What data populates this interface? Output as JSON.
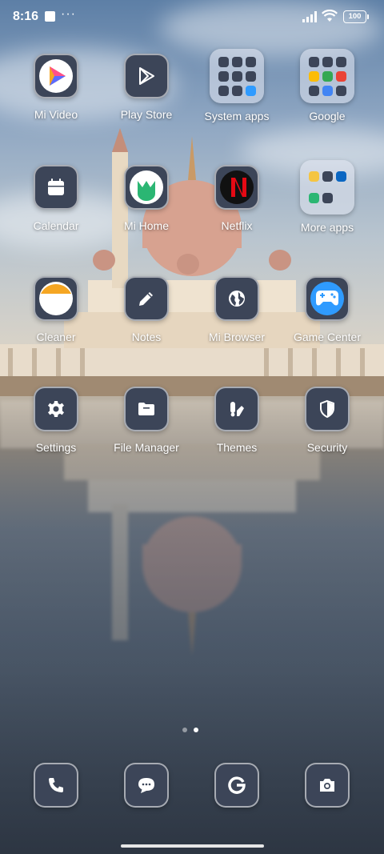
{
  "status_bar": {
    "time": "8:16",
    "more_indicator": "···",
    "battery": "100"
  },
  "apps": [
    {
      "label": "Mi Video",
      "icon": "mi-video-icon"
    },
    {
      "label": "Play Store",
      "icon": "play-store-icon"
    },
    {
      "label": "System apps",
      "icon": "folder-icon"
    },
    {
      "label": "Google",
      "icon": "folder-icon"
    },
    {
      "label": "Calendar",
      "icon": "calendar-icon"
    },
    {
      "label": "Mi Home",
      "icon": "mi-home-icon"
    },
    {
      "label": "Netflix",
      "icon": "netflix-icon"
    },
    {
      "label": "More apps",
      "icon": "folder-icon"
    },
    {
      "label": "Cleaner",
      "icon": "cleaner-icon"
    },
    {
      "label": "Notes",
      "icon": "pencil-icon"
    },
    {
      "label": "Mi Browser",
      "icon": "globe-icon"
    },
    {
      "label": "Game Center",
      "icon": "gamepad-icon"
    },
    {
      "label": "Settings",
      "icon": "gear-icon"
    },
    {
      "label": "File Manager",
      "icon": "folder-file-icon"
    },
    {
      "label": "Themes",
      "icon": "themes-icon"
    },
    {
      "label": "Security",
      "icon": "shield-icon"
    }
  ],
  "dock": [
    {
      "name": "phone",
      "icon": "phone-icon"
    },
    {
      "name": "messages",
      "icon": "chat-icon"
    },
    {
      "name": "browser",
      "icon": "google-g-icon"
    },
    {
      "name": "camera",
      "icon": "camera-icon"
    }
  ],
  "page_indicator": {
    "pages": 2,
    "active": 2
  },
  "colors": {
    "icon_bg": "#3c4558",
    "mi_video_orange": "#f5a623",
    "netflix_red": "#e50914",
    "mi_home_green": "#2bb673",
    "game_center_blue": "#2f9bff"
  }
}
